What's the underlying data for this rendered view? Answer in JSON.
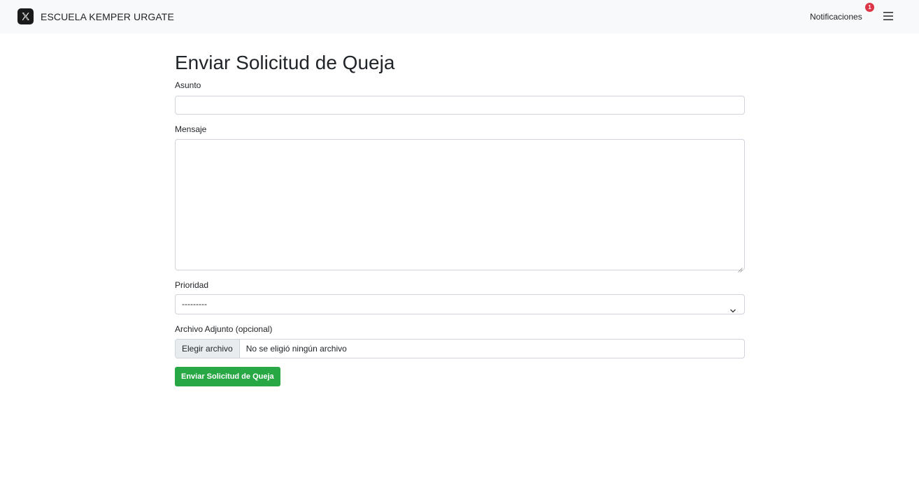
{
  "navbar": {
    "brand_name": "ESCUELA KEMPER URGATE",
    "brand_icon": "x-logo-icon",
    "notifications_label": "Notificaciones",
    "notifications_count": "1",
    "menu_icon": "hamburger-menu-icon"
  },
  "form": {
    "title": "Enviar Solicitud de Queja",
    "asunto": {
      "label": "Asunto",
      "value": ""
    },
    "mensaje": {
      "label": "Mensaje",
      "value": ""
    },
    "prioridad": {
      "label": "Prioridad",
      "selected": "---------"
    },
    "archivo": {
      "label": "Archivo Adjunto (opcional)",
      "button_label": "Elegir archivo",
      "status": "No se eligió ningún archivo"
    },
    "submit_label": "Enviar Solicitud de Queja"
  },
  "colors": {
    "navbar_bg": "#f8f9fa",
    "submit_bg": "#28a745",
    "badge_bg": "#dc3545",
    "input_border": "#ced4da"
  }
}
